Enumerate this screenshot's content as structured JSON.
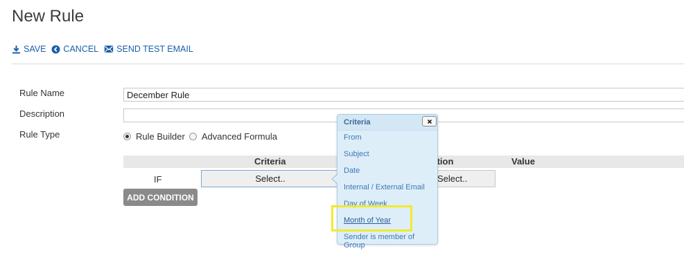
{
  "page": {
    "title": "New Rule"
  },
  "toolbar": {
    "save_label": "SAVE",
    "cancel_label": "CANCEL",
    "send_test_label": "SEND TEST EMAIL"
  },
  "form": {
    "rule_name_label": "Rule Name",
    "rule_name_value": "December Rule",
    "description_label": "Description",
    "description_value": "",
    "rule_type_label": "Rule Type",
    "rule_type_options": [
      {
        "label": "Rule Builder",
        "selected": true
      },
      {
        "label": "Advanced Formula",
        "selected": false
      }
    ]
  },
  "conditions": {
    "headers": {
      "criteria": "Criteria",
      "operation": "Operation",
      "value": "Value"
    },
    "if_label": "IF",
    "criteria_select": "Select..",
    "operation_select": "Select..",
    "add_condition_label": "ADD CONDITION"
  },
  "criteria_popup": {
    "title": "Criteria",
    "items": [
      "From",
      "Subject",
      "Date",
      "Internal / External Email",
      "Day of Week",
      "Month of Year",
      "Sender is member of Group"
    ],
    "highlighted_item": "Month of Year"
  },
  "colors": {
    "link_blue": "#1a5fa8",
    "popup_bg": "#deeef9",
    "highlight_yellow": "#f2ea2a",
    "button_gray": "#8a8a8a"
  }
}
